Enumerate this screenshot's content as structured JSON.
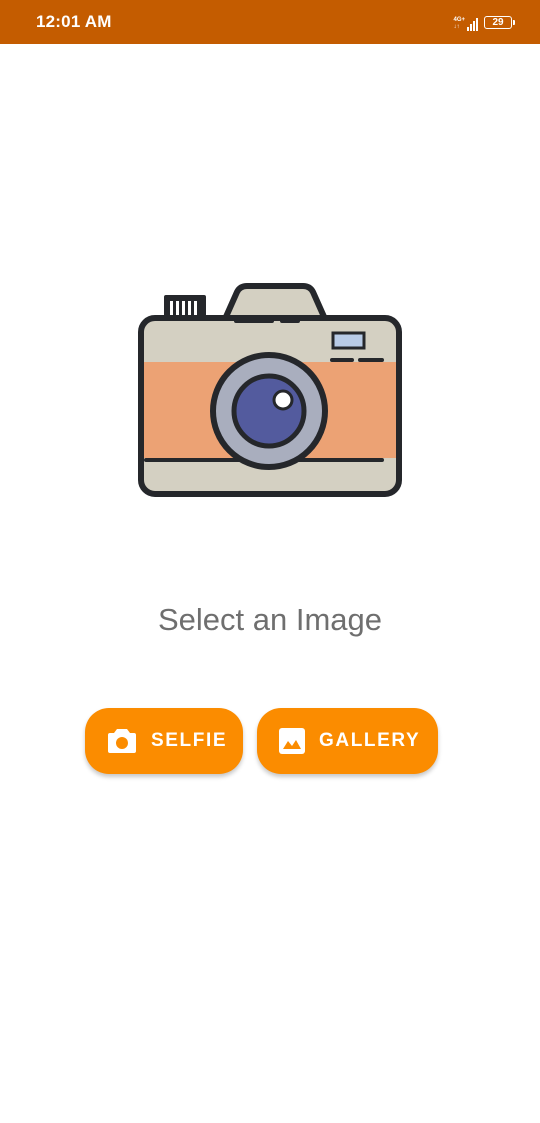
{
  "status_bar": {
    "time": "12:01 AM",
    "network": "4G+",
    "network_sub": "↓↑",
    "battery": "29",
    "background": "#c45c00"
  },
  "main": {
    "illustration_icon": "camera-icon",
    "title": "Select an Image"
  },
  "buttons": {
    "selfie": {
      "label": "SELFIE",
      "icon": "camera-icon"
    },
    "gallery": {
      "label": "GALLERY",
      "icon": "image-icon"
    },
    "color": "#fb8c00"
  }
}
